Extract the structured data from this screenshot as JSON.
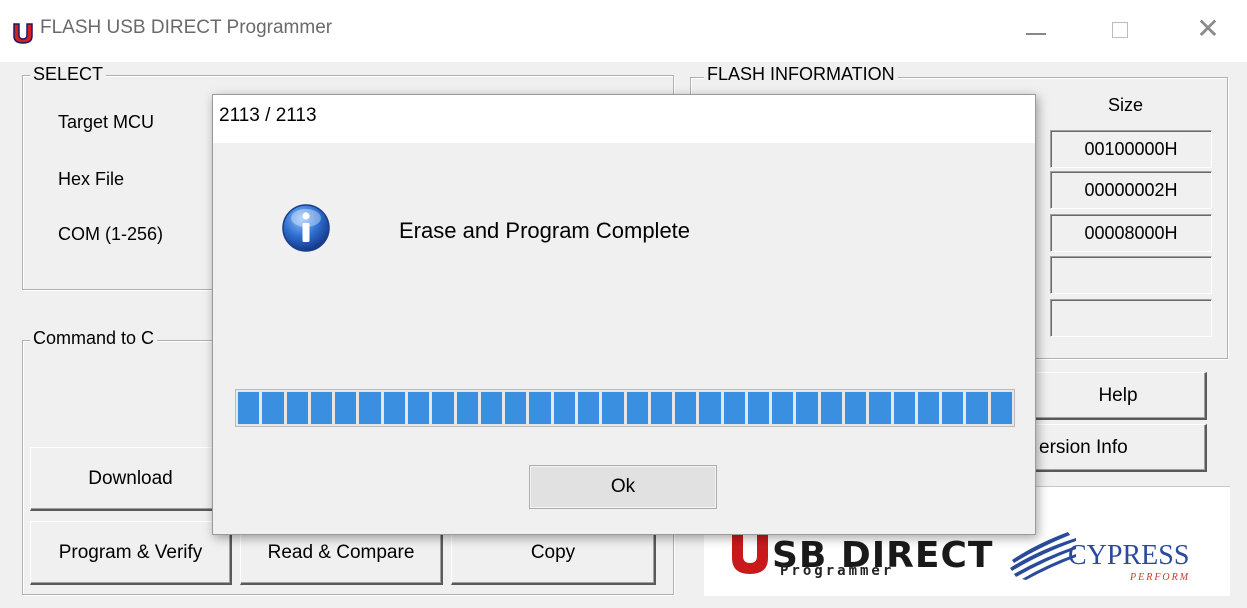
{
  "window": {
    "title": "FLASH USB DIRECT Programmer"
  },
  "select_group": {
    "label": "SELECT",
    "target_mcu_label": "Target MCU",
    "hex_file_label": "Hex File",
    "com_label": "COM (1-256)"
  },
  "command_group": {
    "label": "Command  to  C"
  },
  "flash_info": {
    "label": "FLASH INFORMATION",
    "size_header": "Size",
    "sizes": [
      "00100000H",
      "00000002H",
      "00008000H",
      "",
      ""
    ]
  },
  "buttons": {
    "help": "Help",
    "version_info": "ersion Info",
    "download": "Download",
    "program_verify": "Program & Verify",
    "read_compare": "Read & Compare",
    "copy": "Copy"
  },
  "logos": {
    "usb_direct": "SB DIRECT",
    "programmer": "Programmer",
    "cypress": "CYPRESS",
    "perform": "PERFORM"
  },
  "dialog": {
    "title": "2113 / 2113",
    "message": "Erase and Program Complete",
    "progress_fraction": 1.0,
    "ok_label": "Ok"
  },
  "icons": {
    "app": "app-u-icon",
    "info": "info-icon"
  },
  "colors": {
    "progress": "#3a8fe0",
    "usb_logo_red": "#c81a1a",
    "cypress_blue": "#2a4b9c"
  }
}
